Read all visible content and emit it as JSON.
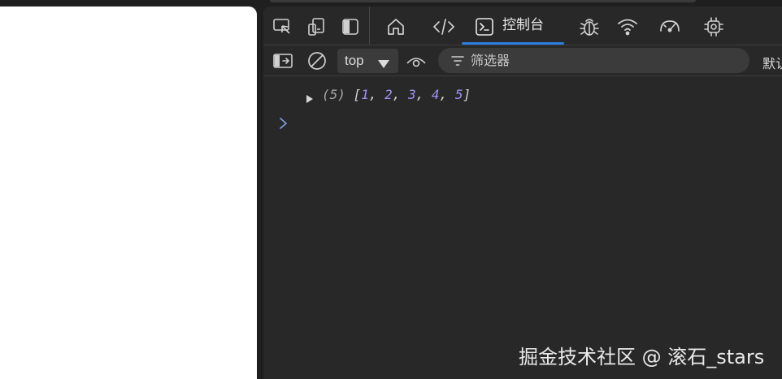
{
  "devtools": {
    "tabs": {
      "console_label": "控制台"
    },
    "toolbar": {
      "context_value": "top",
      "filter_placeholder": "筛选器",
      "levels_label": "默认"
    },
    "console": {
      "log": {
        "count": "(5)",
        "open": "[",
        "close": "]",
        "items": [
          "1",
          "2",
          "3",
          "4",
          "5"
        ],
        "sep": ", "
      },
      "prompt_symbol": "›"
    }
  },
  "watermark": "掘金技术社区 @ 滚石_stars",
  "colors": {
    "accent": "#2b7de0",
    "number": "#9e93f0",
    "prompt": "#7f9bd6"
  }
}
